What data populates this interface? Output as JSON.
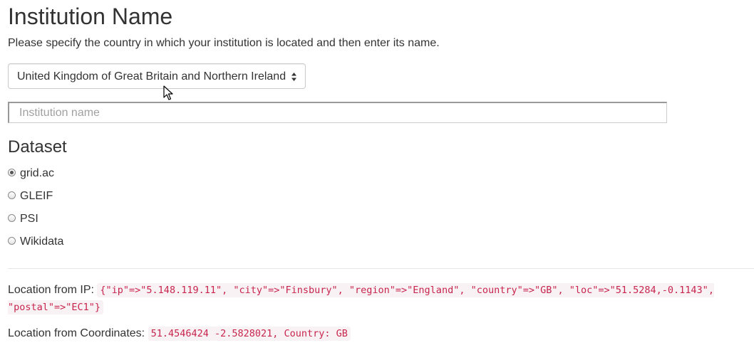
{
  "header": {
    "title": "Institution Name",
    "subtitle": "Please specify the country in which your institution is located and then enter its name."
  },
  "country_select": {
    "value": "United Kingdom of Great Britain and Northern Ireland",
    "icon": "select-arrows-icon"
  },
  "institution_input": {
    "value": "",
    "placeholder": "Institution name"
  },
  "dataset": {
    "title": "Dataset",
    "options": [
      {
        "label": "grid.ac",
        "checked": true
      },
      {
        "label": "GLEIF",
        "checked": false
      },
      {
        "label": "PSI",
        "checked": false
      },
      {
        "label": "Wikidata",
        "checked": false
      }
    ]
  },
  "location": {
    "ip_label": "Location from IP:",
    "ip_value": "{\"ip\"=>\"5.148.119.11\", \"city\"=>\"Finsbury\", \"region\"=>\"England\", \"country\"=>\"GB\", \"loc\"=>\"51.5284,-0.1143\", \"postal\"=>\"EC1\"}",
    "coords_label": "Location from Coordinates:",
    "coords_value": "51.4546424 -2.5828021, Country: GB"
  },
  "colors": {
    "code_text": "#c7254e",
    "code_background": "#f9f2f4",
    "text": "#333333"
  }
}
